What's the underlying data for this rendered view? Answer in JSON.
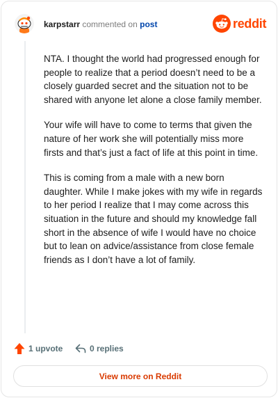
{
  "comment": {
    "author": "karpstarr",
    "verb": "commented on",
    "target": "post",
    "paragraphs": [
      "NTA. I thought the world had progressed enough for people to realize that a period doesn’t need to be a closely guarded secret and the situation not to be shared with anyone let alone a close family member.",
      "Your wife will have to come to terms that given the nature of her work she will potentially miss more firsts and that’s just a fact of life at this point in time.",
      "This is coming from a male with a new born daughter. While I make jokes with my wife in regards to her period I realize that I may come across this situation in the future and should my knowledge fall short in the absence of wife I would have no choice but to lean on advice/assistance from close female friends as I don’t have a lot of family."
    ]
  },
  "brand": {
    "wordmark": "reddit",
    "icon": "reddit-snoo-icon",
    "color": "#ff4500"
  },
  "actions": {
    "upvote_label": "1 upvote",
    "upvote_icon": "upvote-arrow-icon",
    "replies_label": "0 replies",
    "replies_icon": "reply-arrow-icon",
    "upvote_color": "#ff4500"
  },
  "footer": {
    "view_more_label": "View more on Reddit"
  }
}
